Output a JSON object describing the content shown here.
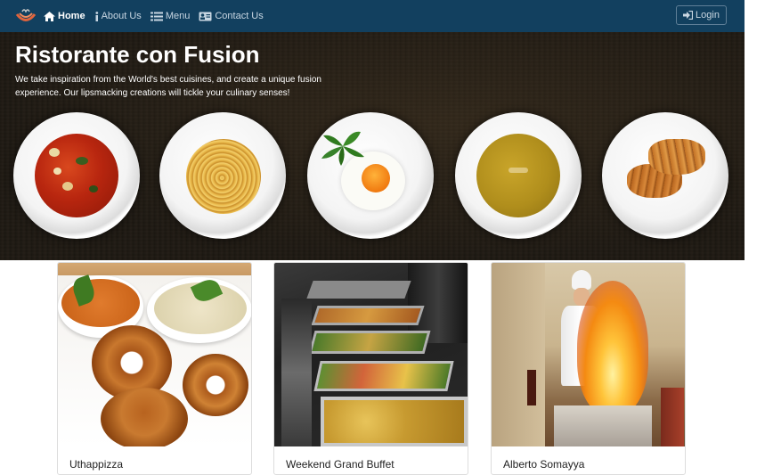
{
  "navbar": {
    "logo_icon": "fusion-logo-icon",
    "items": [
      {
        "label": "Home",
        "icon": "home-icon",
        "active": true
      },
      {
        "label": "About Us",
        "icon": "info-icon",
        "active": false
      },
      {
        "label": "Menu",
        "icon": "list-icon",
        "active": false
      },
      {
        "label": "Contact Us",
        "icon": "address-card-icon",
        "active": false
      }
    ],
    "login_label": "Login",
    "login_icon": "sign-in-icon",
    "background": "#12405f"
  },
  "jumbotron": {
    "title": "Ristorante con Fusion",
    "lead": "We take inspiration from the World's best cuisines, and create a unique fusion experience. Our lipsmacking creations will tickle your culinary senses!"
  },
  "cards": [
    {
      "title": "Uthappizza"
    },
    {
      "title": "Weekend Grand Buffet"
    },
    {
      "title": "Alberto Somayya"
    }
  ]
}
